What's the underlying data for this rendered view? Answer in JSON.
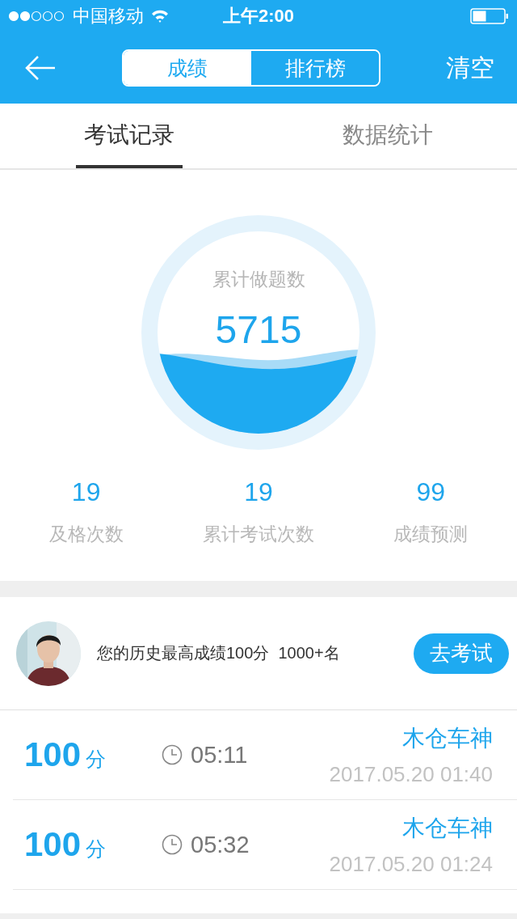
{
  "status_bar": {
    "carrier": "中国移动",
    "time": "上午2:00"
  },
  "nav": {
    "segments": [
      {
        "label": "成绩",
        "selected": true
      },
      {
        "label": "排行榜",
        "selected": false
      }
    ],
    "action": "清空"
  },
  "tabs": [
    {
      "label": "考试记录",
      "selected": true
    },
    {
      "label": "数据统计",
      "selected": false
    }
  ],
  "gauge": {
    "label": "累计做题数",
    "value": "5715"
  },
  "stats": [
    {
      "value": "19",
      "label": "及格次数"
    },
    {
      "value": "19",
      "label": "累计考试次数"
    },
    {
      "value": "99",
      "label": "成绩预测"
    }
  ],
  "profile": {
    "text": "您的历史最高成绩100分  1000+名",
    "button": "去考试"
  },
  "records": [
    {
      "score": "100",
      "unit": "分",
      "duration": "05:11",
      "name": "木仓车神",
      "datetime": "2017.05.20 01:40"
    },
    {
      "score": "100",
      "unit": "分",
      "duration": "05:32",
      "name": "木仓车神",
      "datetime": "2017.05.20 01:24"
    }
  ]
}
